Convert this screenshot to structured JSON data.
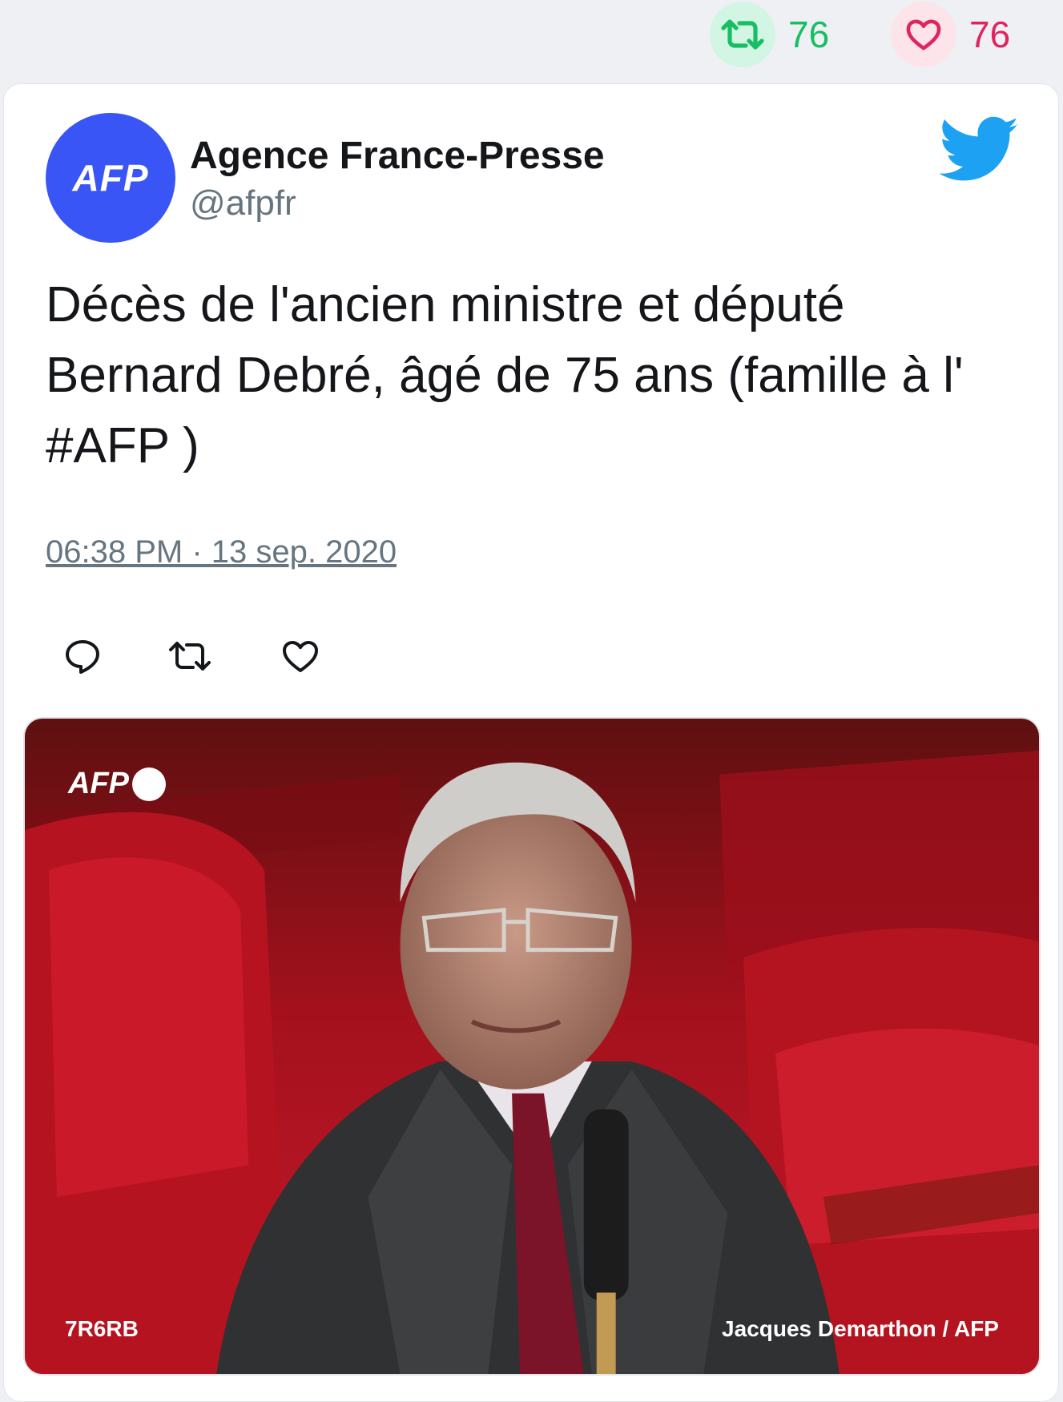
{
  "engagement": {
    "retweet_count": "76",
    "like_count": "76",
    "retweet_color": "#17bf63",
    "like_color": "#e0245e",
    "retweet_icon": "retweet-icon",
    "like_icon": "heart-icon"
  },
  "tweet": {
    "author": {
      "name": "Agence France-Presse",
      "handle": "@afpfr",
      "avatar_text": "AFP",
      "avatar_color": "#3a55f5"
    },
    "platform_icon": "twitter-bird-icon",
    "text": "Décès de l'ancien ministre et député Bernard Debré, âgé de 75 ans (famille à l' #AFP )",
    "timestamp": "06:38 PM · 13 sep. 2020",
    "actions": [
      {
        "name": "reply",
        "icon": "reply-icon"
      },
      {
        "name": "retweet",
        "icon": "retweet-icon"
      },
      {
        "name": "like",
        "icon": "heart-icon"
      }
    ],
    "media": {
      "logo_text": "AFP",
      "code": "7R6RB",
      "credit": "Jacques Demarthon / AFP"
    }
  }
}
